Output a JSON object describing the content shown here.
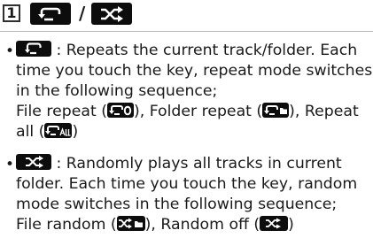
{
  "header": {
    "step_number": "1",
    "separator": "/"
  },
  "repeat_item": {
    "bullet": "•",
    "line1": " : Repeats the current track/folder. Each",
    "line2": "time you touch the key, repeat mode switches",
    "line3": "in the following sequence;",
    "line4_a": "File repeat (",
    "line4_b": "), Folder repeat (",
    "line4_c": "), Repeat",
    "line5_a": "all (",
    "line5_b": ")"
  },
  "random_item": {
    "bullet": "•",
    "line1": " : Randomly plays all tracks in current",
    "line2": "folder. Each time you touch the key, random",
    "line3": "mode switches in the following sequence;",
    "line4_a": "File random (",
    "line4_b": "), Random off (",
    "line4_c": ")"
  },
  "icons": {
    "repeat": "repeat-icon",
    "shuffle": "shuffle-icon",
    "key_fill": "#0d0d0d",
    "glyph_color": "#ffffff"
  }
}
